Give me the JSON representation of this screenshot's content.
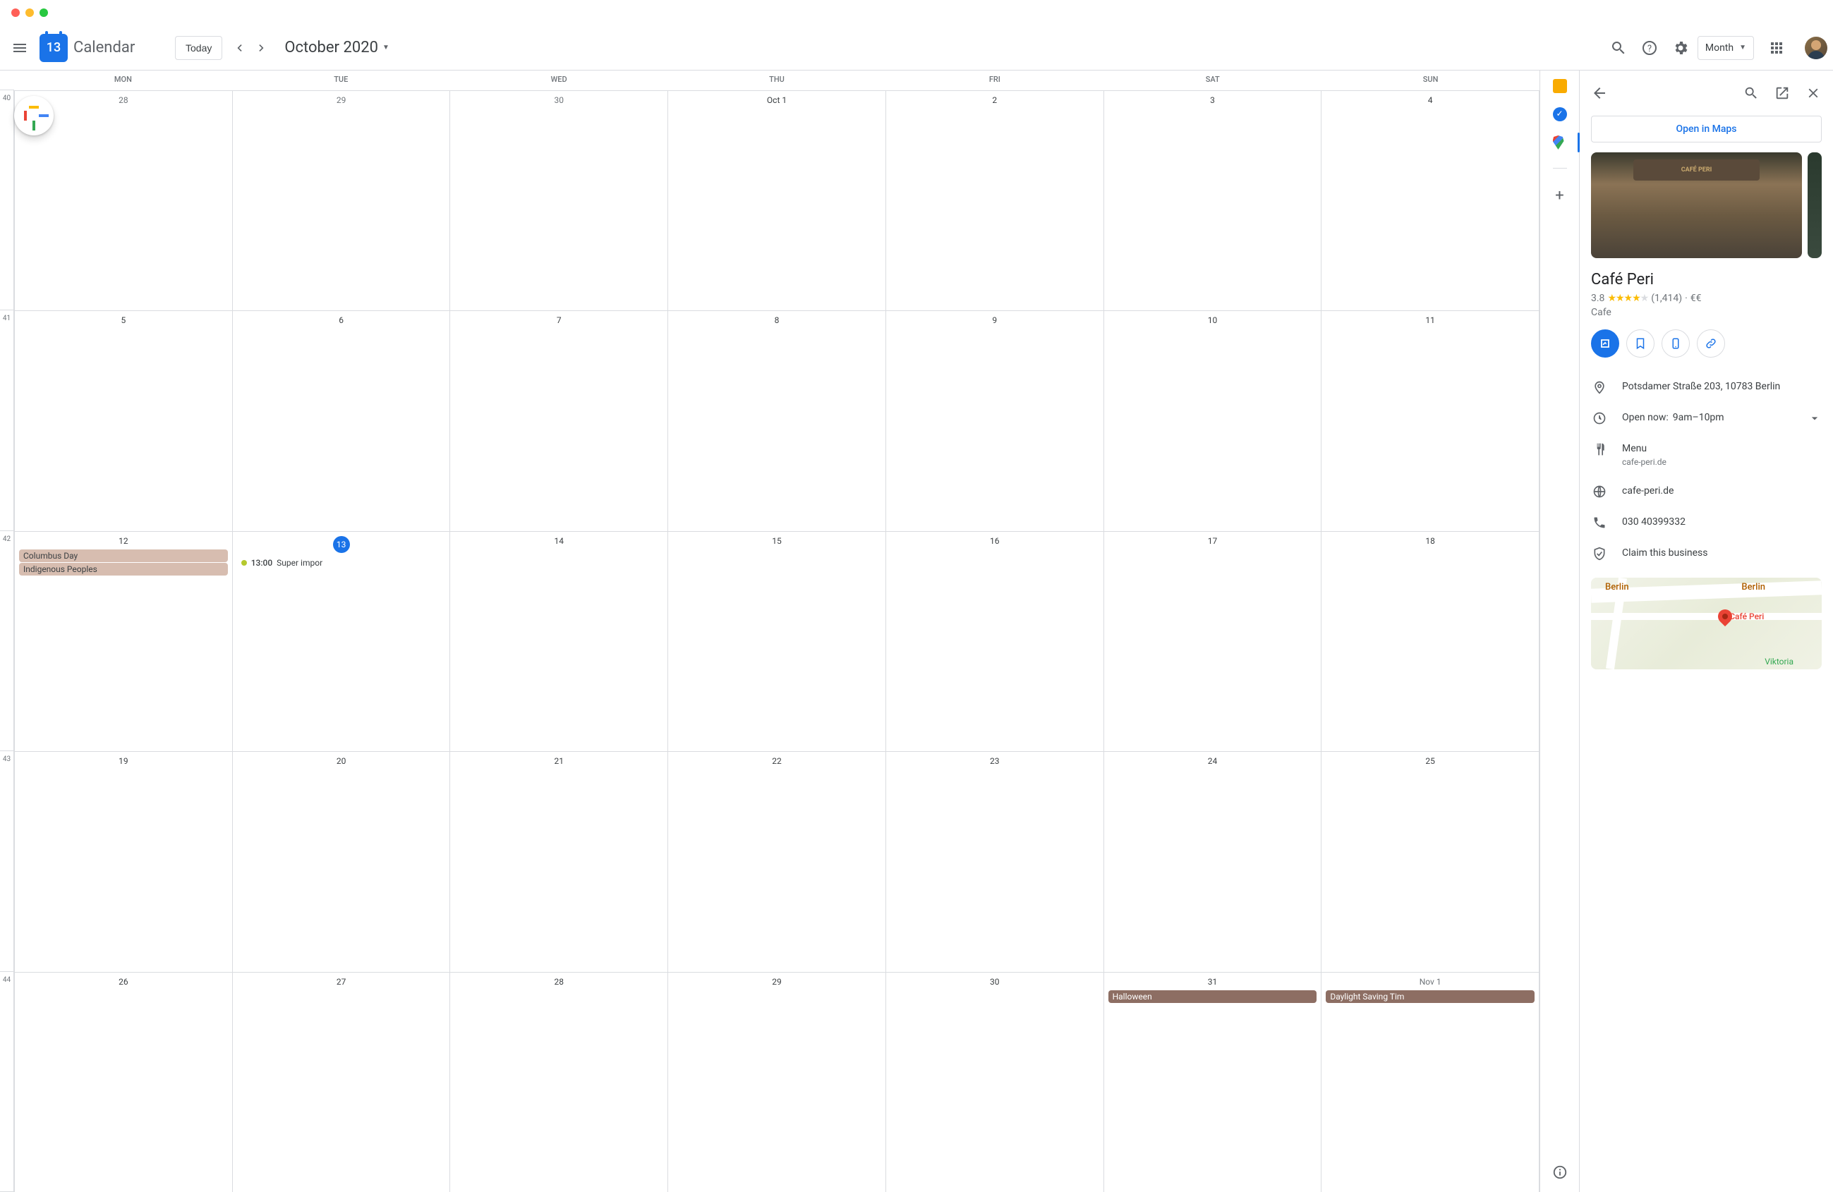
{
  "header": {
    "logo_day": "13",
    "app_name": "Calendar",
    "today_label": "Today",
    "current_range": "October 2020",
    "view_label": "Month"
  },
  "calendar": {
    "day_names": [
      "MON",
      "TUE",
      "WED",
      "THU",
      "FRI",
      "SAT",
      "SUN"
    ],
    "week_numbers": [
      "40",
      "41",
      "42",
      "43",
      "44"
    ],
    "weeks": [
      [
        {
          "num": "28",
          "other": true
        },
        {
          "num": "29",
          "other": true
        },
        {
          "num": "30",
          "other": true
        },
        {
          "num": "Oct 1",
          "first": true
        },
        {
          "num": "2"
        },
        {
          "num": "3"
        },
        {
          "num": "4"
        }
      ],
      [
        {
          "num": "5"
        },
        {
          "num": "6"
        },
        {
          "num": "7"
        },
        {
          "num": "8"
        },
        {
          "num": "9"
        },
        {
          "num": "10"
        },
        {
          "num": "11"
        }
      ],
      [
        {
          "num": "12",
          "events": [
            {
              "type": "holiday-light",
              "label": "Columbus Day"
            },
            {
              "type": "holiday-light",
              "label": "Indigenous Peoples"
            }
          ]
        },
        {
          "num": "13",
          "today": true,
          "events": [
            {
              "type": "timed",
              "time": "13:00",
              "label": "Super impor"
            }
          ]
        },
        {
          "num": "14"
        },
        {
          "num": "15"
        },
        {
          "num": "16"
        },
        {
          "num": "17"
        },
        {
          "num": "18"
        }
      ],
      [
        {
          "num": "19"
        },
        {
          "num": "20"
        },
        {
          "num": "21"
        },
        {
          "num": "22"
        },
        {
          "num": "23"
        },
        {
          "num": "24"
        },
        {
          "num": "25"
        }
      ],
      [
        {
          "num": "26"
        },
        {
          "num": "27"
        },
        {
          "num": "28"
        },
        {
          "num": "29"
        },
        {
          "num": "30"
        },
        {
          "num": "31",
          "events": [
            {
              "type": "holiday-dark",
              "label": "Halloween"
            }
          ]
        },
        {
          "num": "Nov 1",
          "other": true,
          "first": true,
          "events": [
            {
              "type": "holiday-dark",
              "label": "Daylight Saving Tim"
            }
          ]
        }
      ]
    ]
  },
  "panel": {
    "open_maps": "Open in Maps",
    "photo_sign": "CAFÉ PERI",
    "title": "Café Peri",
    "rating": "3.8",
    "reviews": "(1,414)",
    "price": "€€",
    "category": "Cafe",
    "address": "Potsdamer Straße 203, 10783 Berlin",
    "open_now": "Open now:",
    "hours": "9am–10pm",
    "menu_label": "Menu",
    "menu_link": "cafe-peri.de",
    "website": "cafe-peri.de",
    "phone": "030 40399332",
    "claim": "Claim this business",
    "map_berlin": "Berlin",
    "map_berlin2": "Berlin",
    "map_place": "Café Peri",
    "map_viktoria": "Viktoria"
  }
}
